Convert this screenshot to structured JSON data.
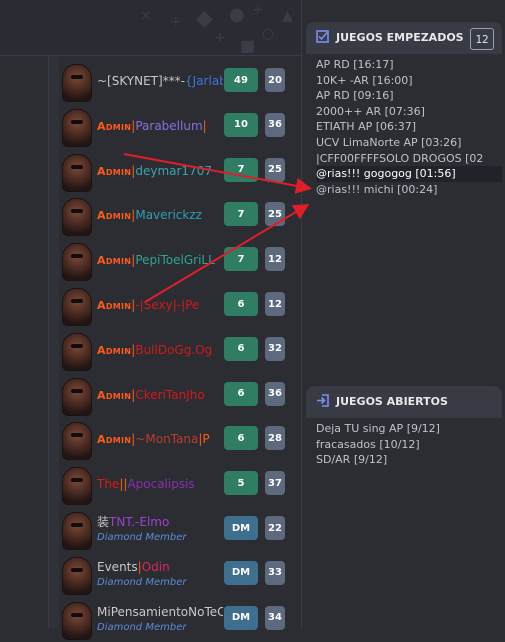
{
  "players": [
    {
      "name_parts": [
        {
          "t": "~[SKYNET]***-",
          "c": "#c9c9c9"
        },
        {
          "t": "{Jarlab",
          "c": "#3f74d8"
        }
      ],
      "admin": false,
      "games": "49",
      "bans": "20"
    },
    {
      "name_parts": [
        {
          "t": "Parabellum",
          "c": "#8a6ee0"
        },
        {
          "t": "|",
          "c": "#ff5a1a"
        }
      ],
      "admin": true,
      "admin_label": "Admin",
      "games": "10",
      "bans": "36"
    },
    {
      "name_parts": [
        {
          "t": "deymar1707",
          "c": "#3aa5b0"
        }
      ],
      "admin": true,
      "admin_label": "Admin",
      "games": "7",
      "bans": "25"
    },
    {
      "name_parts": [
        {
          "t": "Maverickzz",
          "c": "#2f9fb3"
        }
      ],
      "admin": true,
      "admin_label": "Admin",
      "games": "7",
      "bans": "25"
    },
    {
      "name_parts": [
        {
          "t": "PepiToelGriLL",
          "c": "#2fa58f"
        }
      ],
      "admin": true,
      "admin_label": "Admin",
      "games": "7",
      "bans": "12"
    },
    {
      "name_parts": [
        {
          "t": "-|Sexy|-|Pe",
          "c": "#d01a1a"
        }
      ],
      "admin": true,
      "admin_label": "Admin",
      "games": "6",
      "bans": "12"
    },
    {
      "name_parts": [
        {
          "t": "BullDoGg.Og",
          "c": "#d01a1a"
        }
      ],
      "admin": true,
      "admin_label": "Admin",
      "games": "6",
      "bans": "32"
    },
    {
      "name_parts": [
        {
          "t": "CkeriTanJho",
          "c": "#d01a1a"
        }
      ],
      "admin": true,
      "admin_label": "Admin",
      "games": "6",
      "bans": "36"
    },
    {
      "name_parts": [
        {
          "t": "~MonTana",
          "c": "#c0392b"
        },
        {
          "t": "|P",
          "c": "#ff5a1a"
        }
      ],
      "admin": true,
      "admin_label": "Admin",
      "games": "6",
      "bans": "28"
    },
    {
      "name_parts": [
        {
          "t": "The",
          "c": "#e01818"
        },
        {
          "t": "||",
          "c": "#ff5a1a"
        },
        {
          "t": "Apocalipsis",
          "c": "#8a2fb0"
        }
      ],
      "admin": false,
      "games": "5",
      "bans": "37"
    },
    {
      "name_parts": [
        {
          "t": "装",
          "c": "#c9c9c9"
        },
        {
          "t": "TNT.-Elmo",
          "c": "#a040d0"
        }
      ],
      "admin": false,
      "subtitle": "Diamond Member",
      "games": "DM",
      "bans": "22"
    },
    {
      "name_parts": [
        {
          "t": "Events",
          "c": "#c9c9c9"
        },
        {
          "t": "|",
          "c": "#ff5a1a"
        },
        {
          "t": "Odin",
          "c": "#e0245e"
        }
      ],
      "admin": false,
      "subtitle": "Diamond Member",
      "games": "DM",
      "bans": "33"
    },
    {
      "name_parts": [
        {
          "t": "MiPensamientoNoTeC",
          "c": "#c9c9c9"
        }
      ],
      "admin": false,
      "subtitle": "Diamond Member",
      "games": "DM",
      "bans": "34"
    }
  ],
  "started_games": {
    "title": "JUEGOS EMPEZADOS",
    "count": "12",
    "items": [
      {
        "text": "AP RD [16:17]",
        "highlight": false
      },
      {
        "text": "10K+ -AR [16:00]",
        "highlight": false
      },
      {
        "text": "AP RD [09:16]",
        "highlight": false
      },
      {
        "text": "2000++ AR [07:36]",
        "highlight": false
      },
      {
        "text": "ETIATH AP [06:37]",
        "highlight": false
      },
      {
        "text": "UCV LimaNorte AP [03:26]",
        "highlight": false
      },
      {
        "text": "|CFF00FFFFSOLO DROGOS [02",
        "highlight": false
      },
      {
        "text": "@rias!!! gogogog [01:56]",
        "highlight": true
      },
      {
        "text": "@rias!!! michi [00:24]",
        "highlight": false
      }
    ]
  },
  "open_games": {
    "title": "JUEGOS ABIERTOS",
    "items": [
      {
        "text": "Deja TU sing AP [9/12]"
      },
      {
        "text": "fracasados [10/12]"
      },
      {
        "text": "SD/AR [9/12]"
      }
    ]
  },
  "colors": {
    "arrow": "#e01e2a",
    "games_badge": "#2f7d62",
    "dm_badge": "#3f6f8f",
    "bans_badge": "#5d6a7d",
    "admin": "#ff5a1a"
  }
}
